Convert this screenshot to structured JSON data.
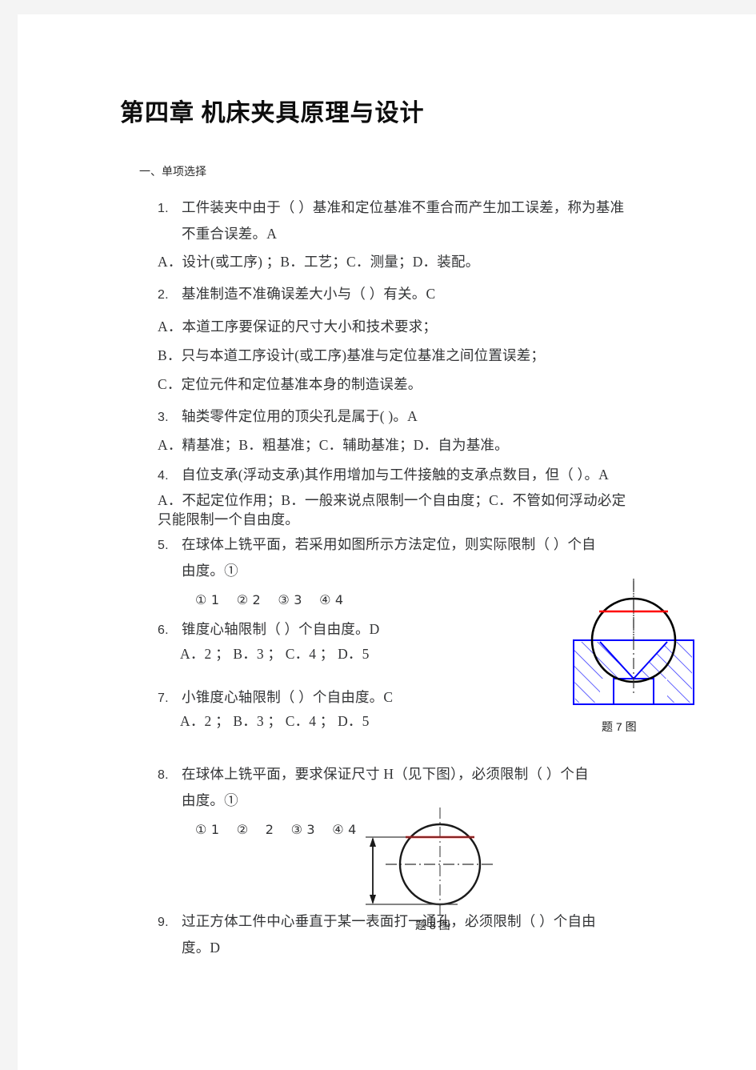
{
  "document": {
    "title": "第四章  机床夹具原理与设计",
    "section_heading": "一、单项选择"
  },
  "questions": [
    {
      "number": "1.",
      "lines": [
        "工件装夹中由于（ ）基准和定位基准不重合而产生加工误差，称为基准",
        "不重合误差。A"
      ],
      "options_line": "A．设计(或工序) ；B．工艺；C．测量；D．装配。"
    },
    {
      "number": "2.",
      "lines": [
        "基准制造不准确误差大小与（ ）有关。C"
      ],
      "options": [
        "A．本道工序要保证的尺寸大小和技术要求；",
        "B．只与本道工序设计(或工序)基准与定位基准之间位置误差；",
        "C．定位元件和定位基准本身的制造误差。"
      ]
    },
    {
      "number": "3.",
      "lines": [
        "轴类零件定位用的顶尖孔是属于(    )。A"
      ],
      "options_line": "A．精基准；B．粗基准；C．辅助基准；D．自为基准。"
    },
    {
      "number": "4.",
      "lines": [
        "自位支承(浮动支承)其作用增加与工件接触的支承点数目，但（ ）。A"
      ],
      "options_wrap": [
        "A．不起定位作用；B．一般来说点限制一个自由度；C．不管如何浮动必定",
        "只能限制一个自由度。"
      ]
    },
    {
      "number": "5.",
      "lines": [
        "在球体上铣平面，若采用如图所示方法定位，则实际限制（      ）个自",
        "由度。①"
      ],
      "choices_line": "① 1　 ② 2　 ③ 3　 ④ 4"
    },
    {
      "number": "6.",
      "lines": [
        "锥度心轴限制（      ）个自由度。D"
      ],
      "options_line": "A．2 ； B．3 ； C．4 ； D．5"
    },
    {
      "number": "7.",
      "lines": [
        "小锥度心轴限制（      ）个自由度。C"
      ],
      "options_line": "A．2 ； B．3 ； C．4 ； D．5"
    },
    {
      "number": "8.",
      "lines": [
        "在球体上铣平面，要求保证尺寸 H（见下图），必须限制（      ）个自",
        "由度。①"
      ],
      "choices_line": "① 1　 ②　 2　 ③ 3　 ④ 4"
    },
    {
      "number": "9.",
      "lines": [
        "过正方体工件中心垂直于某一表面打一通孔，必须限制（      ）个自由",
        "度。D"
      ]
    }
  ],
  "figures": {
    "fig7": {
      "caption": "题 7 图",
      "description": "v-block-with-sphere",
      "colors": {
        "outline": "#000000",
        "fixture": "#0000ff",
        "milled_face": "#ff0000",
        "centerline": "#333333"
      }
    },
    "fig8": {
      "caption": "题 8 图",
      "description": "sphere-with-dimension-H",
      "colors": {
        "outline": "#1a1a1a",
        "milled_face": "#ff0000",
        "dimension": "#333333",
        "centerline": "#555555"
      }
    }
  }
}
